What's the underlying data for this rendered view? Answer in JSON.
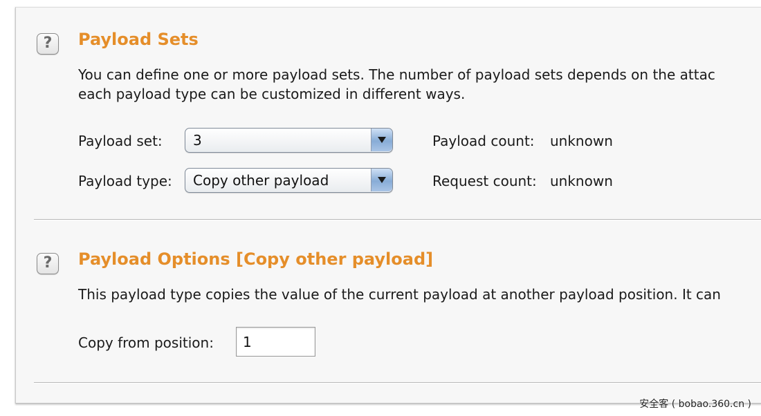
{
  "payload_sets": {
    "heading": "Payload Sets",
    "description_line1": "You can define one or more payload sets. The number of payload sets depends on the attac",
    "description_line2": "each payload type can be customized in different ways.",
    "payload_set_label": "Payload set:",
    "payload_set_value": "3",
    "payload_type_label": "Payload type:",
    "payload_type_value": "Copy other payload",
    "payload_count_label": "Payload count:",
    "payload_count_value": "unknown",
    "request_count_label": "Request count:",
    "request_count_value": "unknown"
  },
  "payload_options": {
    "heading": "Payload Options [Copy other payload]",
    "description": "This payload type copies the value of the current payload at another payload position. It can",
    "copy_from_label": "Copy from position:",
    "copy_from_value": "1"
  },
  "help_icon_glyph": "?",
  "watermark": "安全客 ( bobao.360.cn )",
  "colors": {
    "heading": "#e58e2a",
    "background": "#f7f7f7",
    "text": "#1a1a1a"
  },
  "icons": [
    "help-icon",
    "dropdown-arrow-icon"
  ]
}
